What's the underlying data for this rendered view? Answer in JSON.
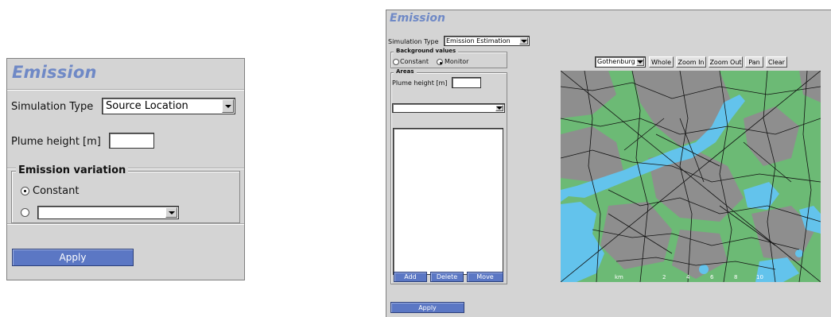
{
  "left": {
    "title": "Emission",
    "simulation_type_label": "Simulation Type",
    "simulation_type_value": "Source Location",
    "plume_height_label": "Plume height [m]",
    "emission_variation_legend": "Emission variation",
    "option_constant": "Constant",
    "apply_label": "Apply"
  },
  "right": {
    "title": "Emission",
    "simulation_type_label": "Simulation Type",
    "simulation_type_value": "Emission Estimation",
    "background_values_legend": "Background values",
    "option_constant": "Constant",
    "option_monitor": "Monitor",
    "areas_legend": "Areas",
    "plume_height_label": "Plume height [m]",
    "add_label": "Add",
    "delete_label": "Delete",
    "move_label": "Move",
    "apply_label": "Apply",
    "map_toolbar": {
      "region_value": "Gothenburg",
      "whole_label": "Whole",
      "zoom_in_label": "Zoom In",
      "zoom_out_label": "Zoom Out",
      "pan_label": "Pan",
      "clear_label": "Clear"
    },
    "map_scale_labels": [
      "2",
      "4",
      "6",
      "8",
      "10"
    ],
    "map_scale_unit": "km",
    "map_colors": {
      "land": "#6cba75",
      "urban": "#8e8e8e",
      "water": "#63c3ec",
      "roads": "#111111"
    }
  }
}
